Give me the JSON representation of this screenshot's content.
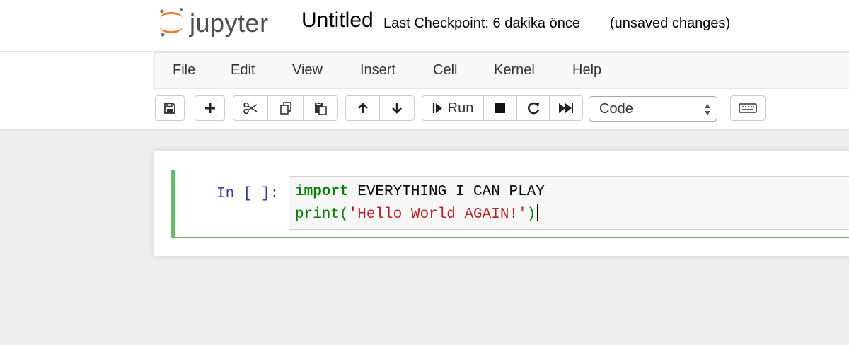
{
  "header": {
    "logo_text": "jupyter",
    "notebook_name": "Untitled",
    "checkpoint": "Last Checkpoint: 6 dakika önce",
    "autosave_status": "(unsaved changes)",
    "logo_colors": [
      "#f37726",
      "#767677"
    ]
  },
  "menubar": {
    "items": [
      "File",
      "Edit",
      "View",
      "Insert",
      "Cell",
      "Kernel",
      "Help"
    ]
  },
  "toolbar": {
    "icons": [
      "save-icon",
      "plus-icon",
      "scissors-icon",
      "copy-icon",
      "paste-icon",
      "arrow-up-icon",
      "arrow-down-icon",
      "step-forward-icon",
      "stop-icon",
      "redo-icon",
      "fast-forward-icon",
      "keyboard-icon"
    ],
    "run_label": "Run",
    "cell_type": "Code"
  },
  "cell": {
    "prompt": "In [ ]:",
    "lines": [
      {
        "keyword": "import",
        "rest": " EVERYTHING I CAN PLAY"
      },
      {
        "func": "print",
        "open": "(",
        "string": "'Hello World AGAIN!'",
        "close": ")"
      }
    ],
    "accent_color": "#66bb6a"
  }
}
